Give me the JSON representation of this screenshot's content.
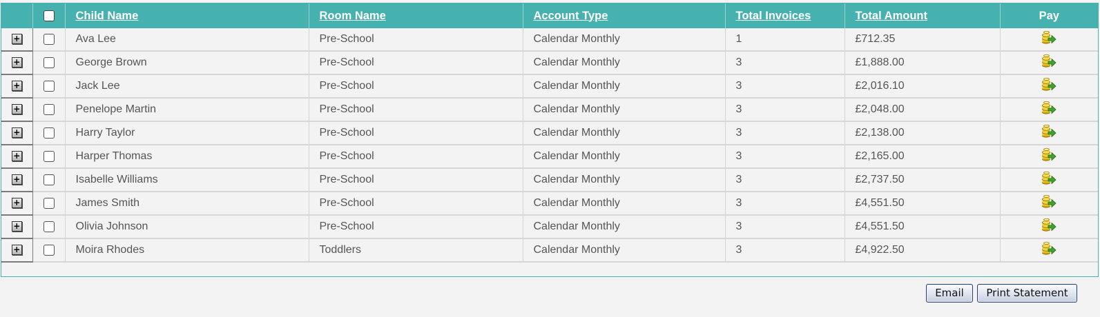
{
  "grid": {
    "columns": {
      "child_name": "Child Name",
      "room_name": "Room Name",
      "account_type": "Account Type",
      "total_invoices": "Total Invoices",
      "total_amount": "Total Amount",
      "pay": "Pay"
    },
    "expand_glyph": "+",
    "pay_icon": "coins-arrow-icon",
    "rows": [
      {
        "child": "Ava Lee",
        "room": "Pre-School",
        "account": "Calendar Monthly",
        "invoices": "1",
        "amount": "£712.35"
      },
      {
        "child": "George Brown",
        "room": "Pre-School",
        "account": "Calendar Monthly",
        "invoices": "3",
        "amount": "£1,888.00"
      },
      {
        "child": "Jack Lee",
        "room": "Pre-School",
        "account": "Calendar Monthly",
        "invoices": "3",
        "amount": "£2,016.10"
      },
      {
        "child": "Penelope Martin",
        "room": "Pre-School",
        "account": "Calendar Monthly",
        "invoices": "3",
        "amount": "£2,048.00"
      },
      {
        "child": "Harry Taylor",
        "room": "Pre-School",
        "account": "Calendar Monthly",
        "invoices": "3",
        "amount": "£2,138.00"
      },
      {
        "child": "Harper Thomas",
        "room": "Pre-School",
        "account": "Calendar Monthly",
        "invoices": "3",
        "amount": "£2,165.00"
      },
      {
        "child": "Isabelle Williams",
        "room": "Pre-School",
        "account": "Calendar Monthly",
        "invoices": "3",
        "amount": "£2,737.50"
      },
      {
        "child": "James Smith",
        "room": "Pre-School",
        "account": "Calendar Monthly",
        "invoices": "3",
        "amount": "£4,551.50"
      },
      {
        "child": "Olivia Johnson",
        "room": "Pre-School",
        "account": "Calendar Monthly",
        "invoices": "3",
        "amount": "£4,551.50"
      },
      {
        "child": "Moira Rhodes",
        "room": "Toddlers",
        "account": "Calendar Monthly",
        "invoices": "3",
        "amount": "£4,922.50"
      }
    ]
  },
  "buttons": {
    "email": "Email",
    "print_statement": "Print Statement"
  },
  "colors": {
    "header_bg": "#45b2af",
    "row_bg": "#f3f3f3",
    "button_border": "#2c3e70"
  }
}
